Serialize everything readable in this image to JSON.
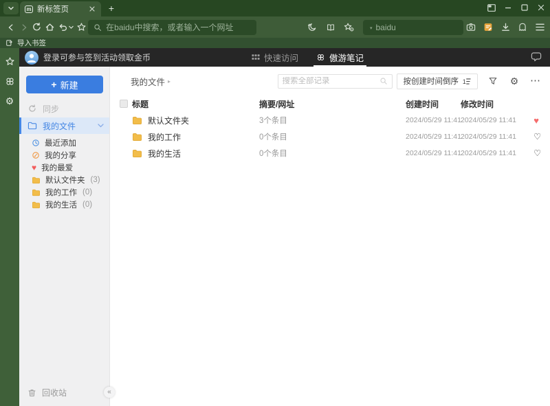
{
  "colors": {
    "titlebar_green": "#274722",
    "toolbar_green": "#3e5c38",
    "addressbar_green": "#2b4a27",
    "bookmarkbar_green": "#325030",
    "edge_strip_green": "#3f6039",
    "page_header_dark": "#262626",
    "sidebar_gray": "#f0f0f1",
    "accent_blue": "#3a7de0",
    "selected_blue": "#4486e4",
    "selected_blue_bg": "#dce8f8",
    "folder_yellow": "#f2bd4a",
    "note_orange": "#e8a53c",
    "heart_red": "#f56c6c"
  },
  "icons": {
    "plus": "+",
    "gear": "⚙",
    "dots": "⋯",
    "collapse": "«",
    "caret_down": "▾",
    "breadcrumb_arrow": "▸",
    "star": "☆"
  },
  "browser": {
    "tab": {
      "title": "新标签页"
    },
    "address_bar": {
      "placeholder": "在baidu中搜索，或者输入一个网址"
    },
    "search_box": {
      "placeholder": "baidu"
    },
    "bookmark_bar": {
      "import_label": "导入书签"
    }
  },
  "page": {
    "header": {
      "login_text": "登录可参与签到活动领取金币",
      "tabs": [
        {
          "label": "快速访问"
        },
        {
          "label": "傲游笔记"
        }
      ]
    },
    "sidebar": {
      "new_button_label": "新建",
      "sync_label": "同步",
      "my_files_label": "我的文件",
      "items": [
        {
          "label": "最近添加",
          "count": ""
        },
        {
          "label": "我的分享",
          "count": ""
        },
        {
          "label": "我的最爱",
          "count": ""
        },
        {
          "label": "默认文件夹",
          "count": "(3)"
        },
        {
          "label": "我的工作",
          "count": "(0)"
        },
        {
          "label": "我的生活",
          "count": "(0)"
        }
      ],
      "trash_label": "回收站"
    },
    "toolbar": {
      "breadcrumb": "我的文件",
      "search_placeholder": "搜索全部记录",
      "sort_label": "按创建时间倒序"
    },
    "table": {
      "headers": {
        "title": "标题",
        "summary": "摘要/网址",
        "created": "创建时间",
        "modified": "修改时间"
      },
      "rows": [
        {
          "title": "默认文件夹",
          "summary": "3个条目",
          "created": "2024/05/29 11:41",
          "modified": "2024/05/29 11:41",
          "heart": "♥"
        },
        {
          "title": "我的工作",
          "summary": "0个条目",
          "created": "2024/05/29 11:41",
          "modified": "2024/05/29 11:41",
          "heart": "♡"
        },
        {
          "title": "我的生活",
          "summary": "0个条目",
          "created": "2024/05/29 11:41",
          "modified": "2024/05/29 11:41",
          "heart": "♡"
        }
      ]
    }
  }
}
